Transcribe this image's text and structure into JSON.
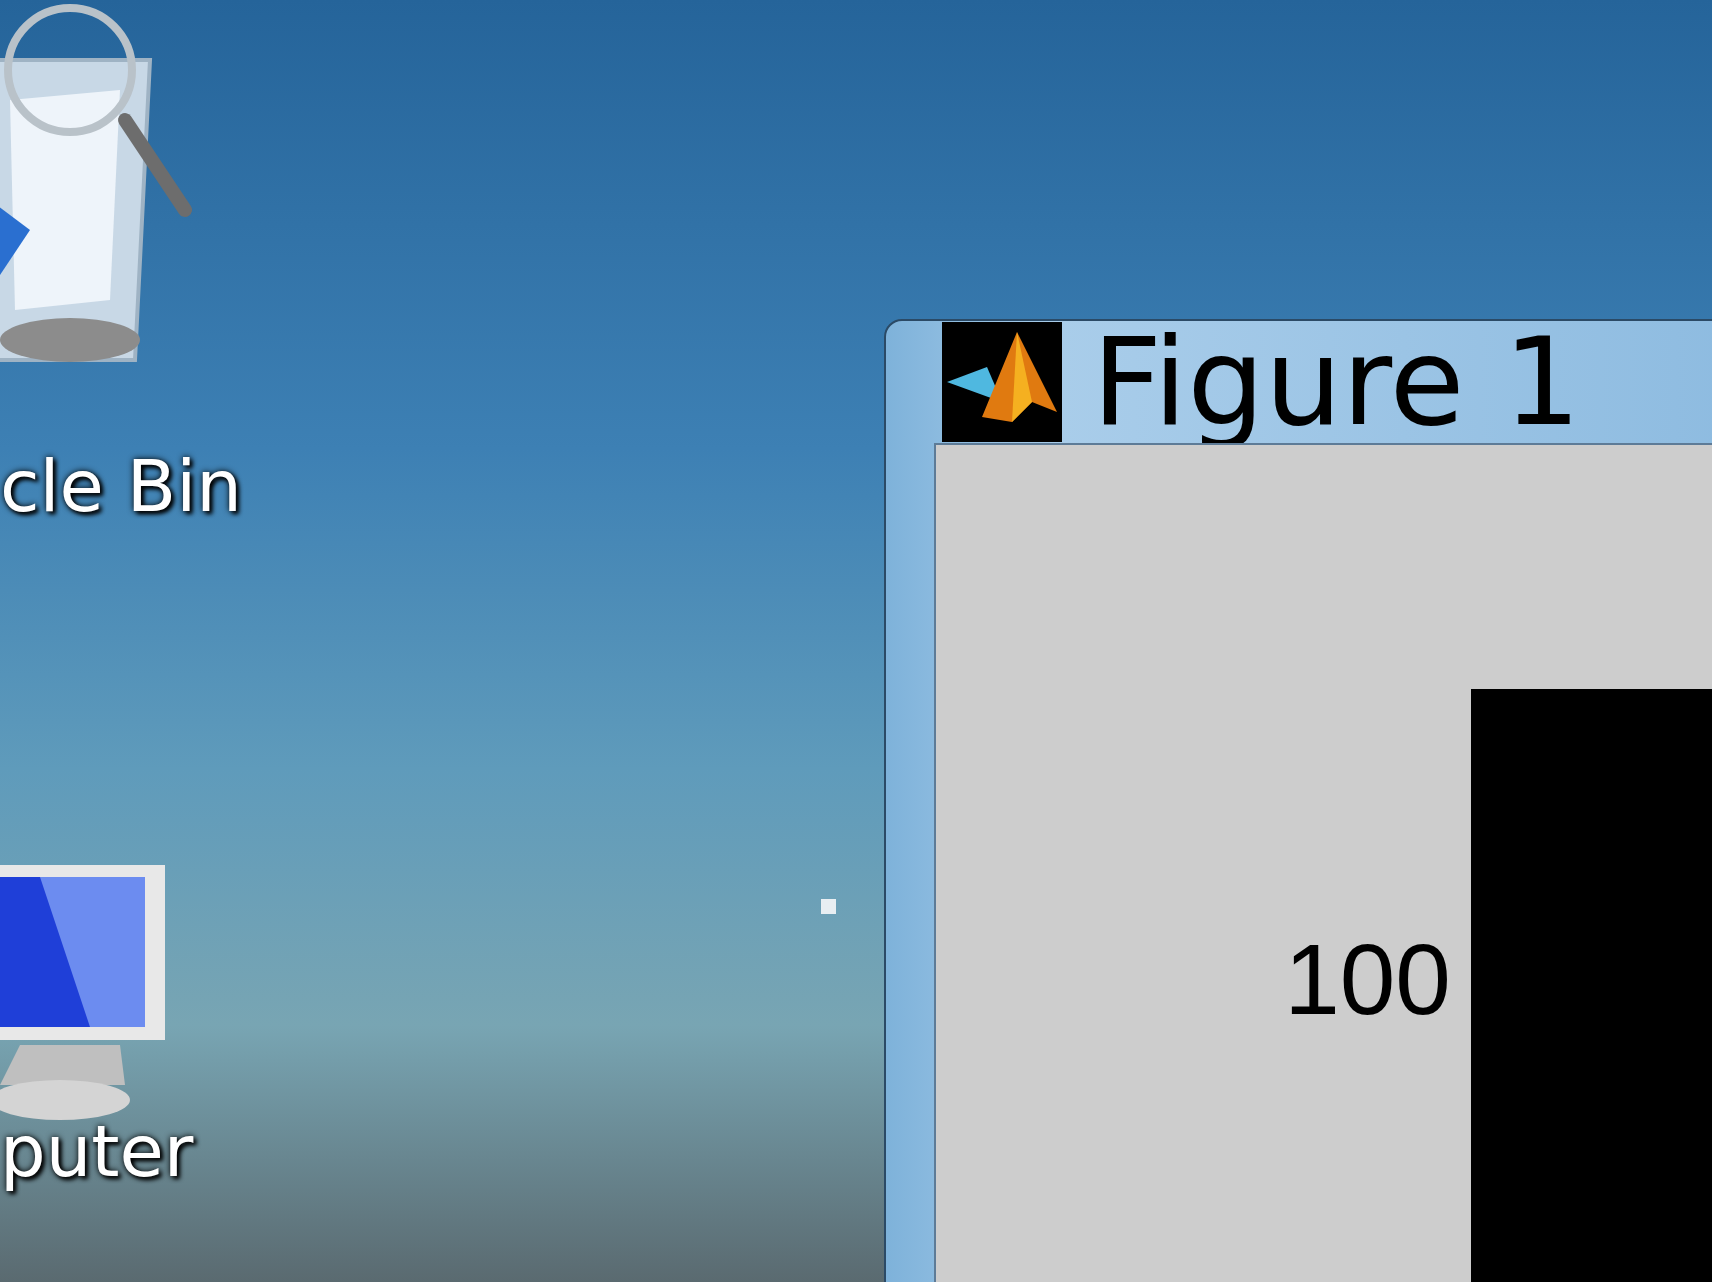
{
  "desktop_icons": [
    {
      "kind": "recycle-bin",
      "label": "cle Bin"
    },
    {
      "kind": "computer",
      "label": "puter"
    }
  ],
  "window": {
    "title": "Figure 1",
    "axes": {
      "y_tick_labels": [
        "100"
      ]
    }
  }
}
